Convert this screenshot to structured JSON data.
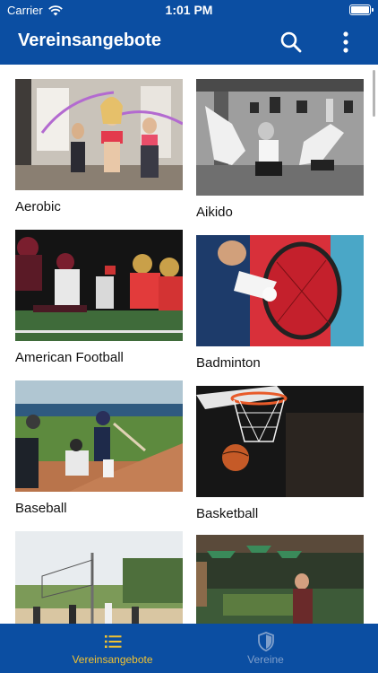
{
  "status_bar": {
    "carrier": "Carrier",
    "time": "1:01 PM"
  },
  "nav": {
    "title": "Vereinsangebote",
    "search_icon": "search-icon",
    "more_icon": "more-vertical-icon"
  },
  "sports": [
    {
      "label": "Aerobic"
    },
    {
      "label": "Aikido"
    },
    {
      "label": "American Football"
    },
    {
      "label": "Badminton"
    },
    {
      "label": "Baseball"
    },
    {
      "label": "Basketball"
    },
    {
      "label": ""
    },
    {
      "label": ""
    }
  ],
  "tabbar": {
    "tabs": [
      {
        "label": "Vereinsangebote",
        "icon": "list-icon",
        "active": true
      },
      {
        "label": "Vereine",
        "icon": "shield-icon",
        "active": false
      }
    ]
  },
  "colors": {
    "primary": "#0b4ea2",
    "active_tab": "#f1c232",
    "inactive_tab": "#7f9fcb"
  }
}
